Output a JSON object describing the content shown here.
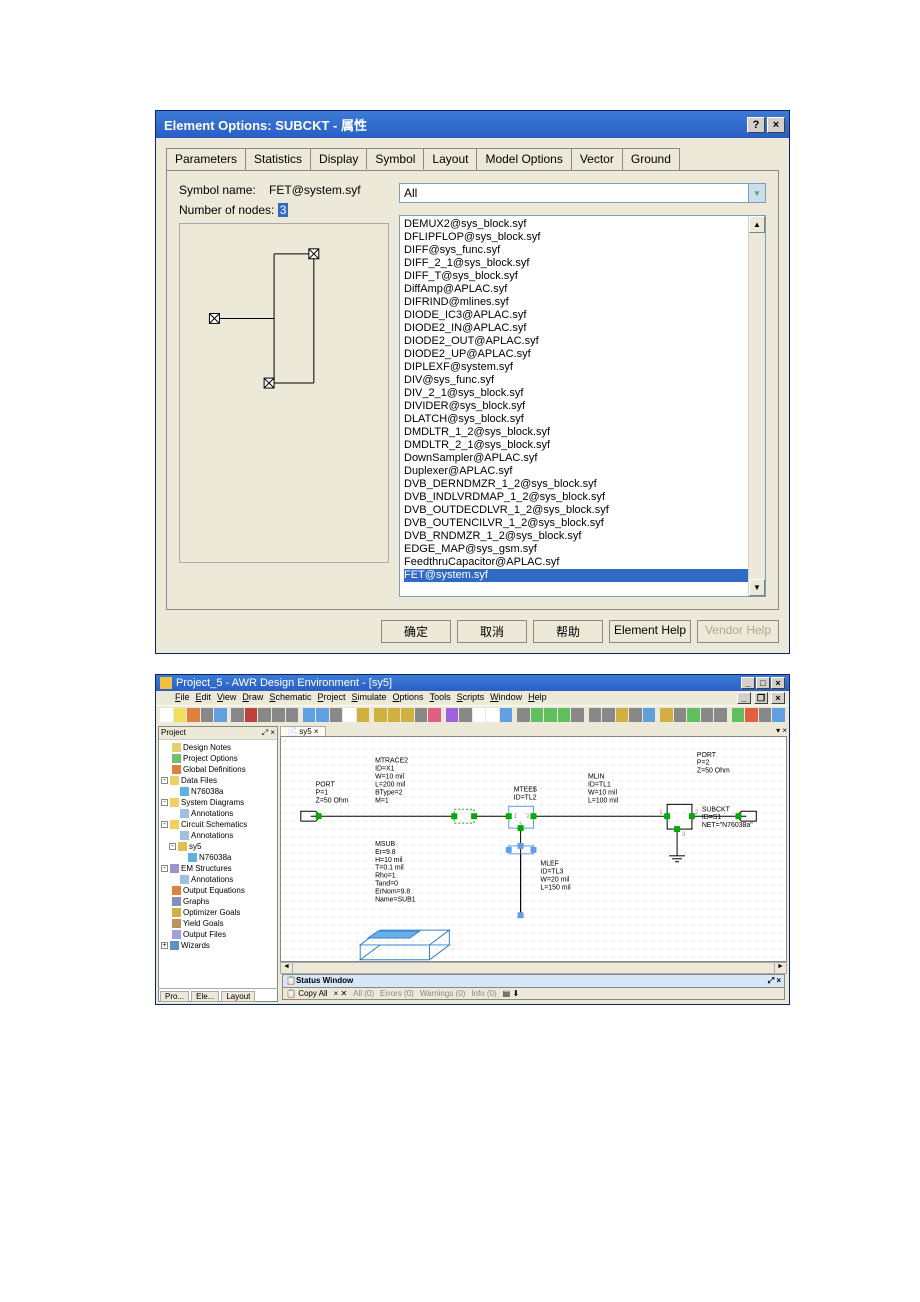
{
  "dialog1": {
    "title": "Element Options: SUBCKT - 属性",
    "tabs": [
      "Parameters",
      "Statistics",
      "Display",
      "Symbol",
      "Layout",
      "Model Options",
      "Vector",
      "Ground"
    ],
    "active_tab": 3,
    "symbol_name_label": "Symbol name:",
    "symbol_name_value": "FET@system.syf",
    "nodes_label": "Number of nodes:",
    "nodes_value": "3",
    "combo_value": "All",
    "list_items": [
      "DEMUX2@sys_block.syf",
      "DFLIPFLOP@sys_block.syf",
      "DIFF@sys_func.syf",
      "DIFF_2_1@sys_block.syf",
      "DIFF_T@sys_block.syf",
      "DiffAmp@APLAC.syf",
      "DIFRIND@mlines.syf",
      "DIODE_IC3@APLAC.syf",
      "DIODE2_IN@APLAC.syf",
      "DIODE2_OUT@APLAC.syf",
      "DIODE2_UP@APLAC.syf",
      "DIPLEXF@system.syf",
      "DIV@sys_func.syf",
      "DIV_2_1@sys_block.syf",
      "DIVIDER@sys_block.syf",
      "DLATCH@sys_block.syf",
      "DMDLTR_1_2@sys_block.syf",
      "DMDLTR_2_1@sys_block.syf",
      "DownSampler@APLAC.syf",
      "Duplexer@APLAC.syf",
      "DVB_DERNDMZR_1_2@sys_block.syf",
      "DVB_INDLVRDMAP_1_2@sys_block.syf",
      "DVB_OUTDECDLVR_1_2@sys_block.syf",
      "DVB_OUTENCILVR_1_2@sys_block.syf",
      "DVB_RNDMZR_1_2@sys_block.syf",
      "EDGE_MAP@sys_gsm.syf",
      "FeedthruCapacitor@APLAC.syf",
      "FET@system.syf"
    ],
    "selected_index": 27,
    "buttons": {
      "ok": "确定",
      "cancel": "取消",
      "help": "帮助",
      "ehelp": "Element Help",
      "vhelp": "Vendor Help"
    }
  },
  "win2": {
    "title": "Project_5 - AWR Design Environment - [sy5]",
    "menus": [
      "File",
      "Edit",
      "View",
      "Draw",
      "Schematic",
      "Project",
      "Simulate",
      "Options",
      "Tools",
      "Scripts",
      "Window",
      "Help"
    ],
    "proj_header": "Project",
    "canvas_tab": "sy5",
    "tree": [
      {
        "lvl": 0,
        "ic": "#e0d070",
        "t": "Design Notes"
      },
      {
        "lvl": 0,
        "ic": "#70c070",
        "t": "Project Options"
      },
      {
        "lvl": 0,
        "ic": "#e08040",
        "t": "Global Definitions"
      },
      {
        "lvl": 0,
        "ic": "#f0d060",
        "t": "Data Files",
        "exp": "-"
      },
      {
        "lvl": 1,
        "ic": "#60b0e0",
        "t": "N76038a"
      },
      {
        "lvl": 0,
        "ic": "#f0d060",
        "t": "System Diagrams",
        "exp": "-"
      },
      {
        "lvl": 1,
        "ic": "#a0c0e0",
        "t": "Annotations"
      },
      {
        "lvl": 0,
        "ic": "#f0d060",
        "t": "Circuit Schematics",
        "exp": "-"
      },
      {
        "lvl": 1,
        "ic": "#a0c0e0",
        "t": "Annotations"
      },
      {
        "lvl": 1,
        "ic": "#e0c050",
        "t": "sy5",
        "exp": "-"
      },
      {
        "lvl": 2,
        "ic": "#60b0e0",
        "t": "N76038a"
      },
      {
        "lvl": 0,
        "ic": "#a090d0",
        "t": "EM Structures",
        "exp": "-"
      },
      {
        "lvl": 1,
        "ic": "#a0c0e0",
        "t": "Annotations"
      },
      {
        "lvl": 0,
        "ic": "#e08040",
        "t": "Output Equations"
      },
      {
        "lvl": 0,
        "ic": "#8090c0",
        "t": "Graphs"
      },
      {
        "lvl": 0,
        "ic": "#d0b040",
        "t": "Optimizer Goals"
      },
      {
        "lvl": 0,
        "ic": "#c09060",
        "t": "Yield Goals"
      },
      {
        "lvl": 0,
        "ic": "#a0a0e0",
        "t": "Output Files"
      },
      {
        "lvl": 0,
        "ic": "#6090c0",
        "t": "Wizards",
        "exp": "+"
      }
    ],
    "bottom_tabs": [
      "Pro...",
      "Ele...",
      "Layout"
    ],
    "schematic": {
      "port1": {
        "lbl": "PORT",
        "p": "P=1",
        "z": "Z=50 Ohm"
      },
      "mtrace": {
        "lbl": "MTRACE2",
        "id": "ID=X1",
        "w": "W=10 mil",
        "l": "L=200 mil",
        "bt": "BType=2",
        "m": "M=1"
      },
      "mtee": {
        "lbl": "MTEE$",
        "id": "ID=TL2"
      },
      "mlin": {
        "lbl": "MLIN",
        "id": "ID=TL1",
        "w": "W=10 mil",
        "l": "L=100 mil"
      },
      "port2": {
        "lbl": "PORT",
        "p": "P=2",
        "z": "Z=50 Ohm"
      },
      "subckt": {
        "lbl": "SUBCKT",
        "id": "ID=S1",
        "net": "NET=\"N76038a\""
      },
      "msub": {
        "lbl": "MSUB",
        "er": "Er=9.8",
        "h": "H=10 mil",
        "t": "T=0.1 mil",
        "rho": "Rho=1",
        "tand": "Tand=0",
        "ern": "ErNom=9.8",
        "name": "Name=SUB1"
      },
      "mlef": {
        "lbl": "MLEF",
        "id": "ID=TL3",
        "w": "W=20 mil",
        "l": "L=150 mil"
      }
    },
    "status_title": "Status Window",
    "status_items": {
      "copy": "Copy All",
      "all": "All (0)",
      "err": "Errors (0)",
      "warn": "Warnings (0)",
      "info": "Info (0)"
    }
  }
}
